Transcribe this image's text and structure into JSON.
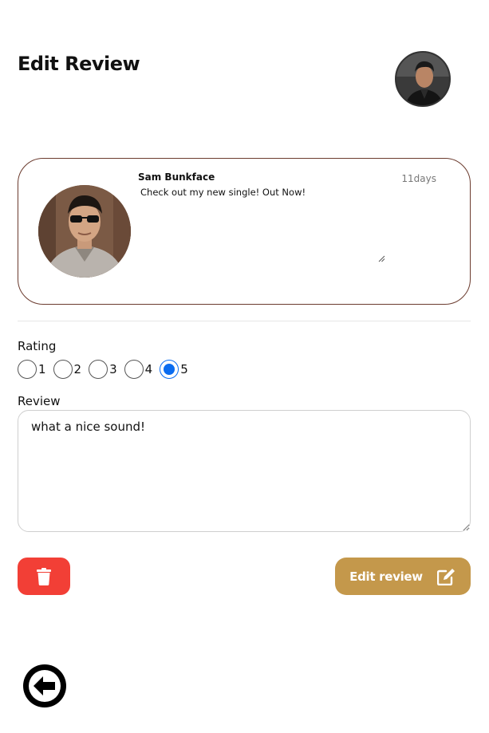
{
  "header": {
    "title": "Edit Review",
    "user_avatar": "user-avatar"
  },
  "post": {
    "author": "Sam Bunkface",
    "time": "11days",
    "text": "Check out my new single! Out Now!",
    "avatar": "artist-avatar"
  },
  "rating": {
    "label": "Rating",
    "options": [
      "1",
      "2",
      "3",
      "4",
      "5"
    ],
    "selected": "5",
    "selected_color": "#0a6cf0"
  },
  "review": {
    "label": "Review",
    "value": "what a nice sound!"
  },
  "actions": {
    "delete_icon": "trash-icon",
    "delete_color": "#f23f36",
    "edit_label": "Edit review",
    "edit_icon": "edit-icon",
    "edit_color": "#c4984b",
    "back_icon": "arrow-left-icon"
  },
  "colors": {
    "card_border": "#6b3b2e"
  }
}
